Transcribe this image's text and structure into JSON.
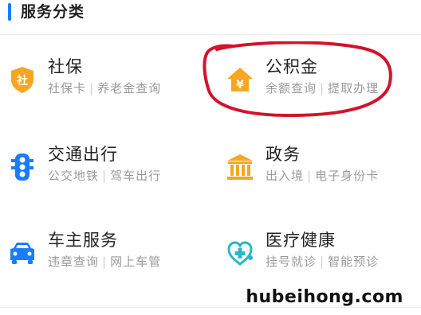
{
  "header": {
    "title": "服务分类"
  },
  "services": [
    {
      "title": "社保",
      "sub": [
        "社保卡",
        "养老金查询"
      ]
    },
    {
      "title": "公积金",
      "sub": [
        "余额查询",
        "提取办理"
      ]
    },
    {
      "title": "交通出行",
      "sub": [
        "公交地铁",
        "驾车出行"
      ]
    },
    {
      "title": "政务",
      "sub": [
        "出入境",
        "电子身份卡"
      ]
    },
    {
      "title": "车主服务",
      "sub": [
        "违章查询",
        "网上车管"
      ]
    },
    {
      "title": "医疗健康",
      "sub": [
        "挂号就诊",
        "智能预诊"
      ]
    }
  ],
  "icons": {
    "shebao": {
      "name": "shield-social-icon",
      "glyph": "社",
      "color": "#f5a623"
    },
    "gongjijin": {
      "name": "house-yen-icon",
      "glyph": "¥",
      "color": "#f5a623"
    },
    "traffic": {
      "name": "traffic-light-icon",
      "color": "#1a7cff"
    },
    "zhengwu": {
      "name": "government-building-icon",
      "color": "#f5a623"
    },
    "car": {
      "name": "car-icon",
      "color": "#1a7cff"
    },
    "medical": {
      "name": "stethoscope-heart-icon",
      "color": "#2bb5c9"
    }
  },
  "annotation": {
    "color": "#d1142b"
  },
  "watermark": "hubeihong.com"
}
